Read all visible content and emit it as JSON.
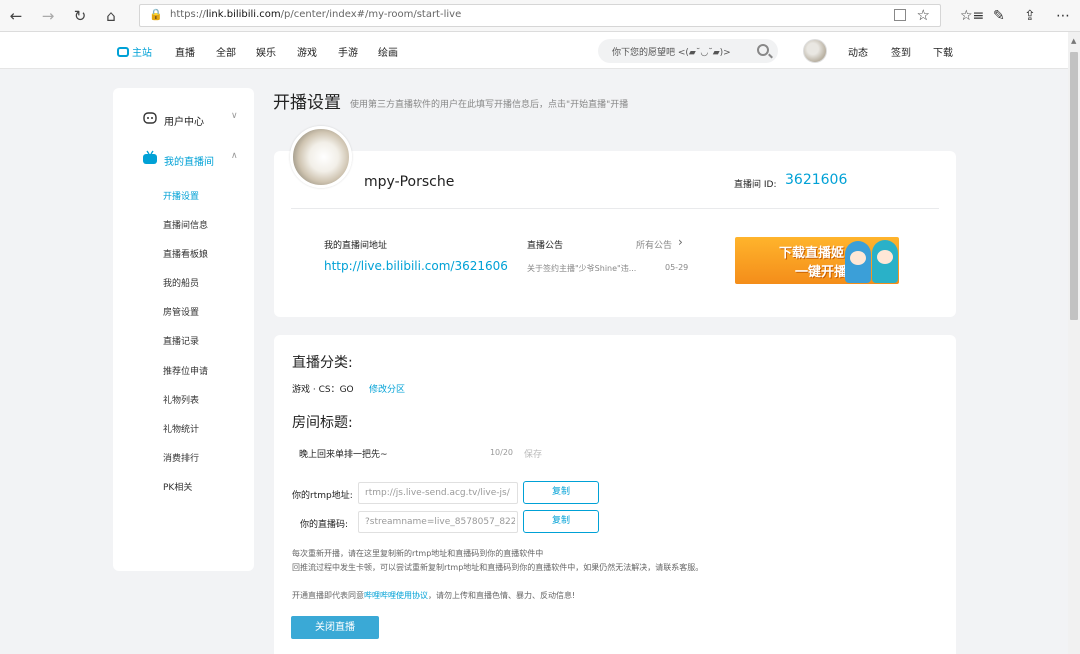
{
  "browser": {
    "back": "←",
    "forward": "→",
    "refresh": "↻",
    "home": "⌂",
    "url_prefix": "https://",
    "url_host": "link.bilibili.com",
    "url_path": "/p/center/index#/my-room/start-live",
    "icons": [
      "back-icon",
      "forward-icon",
      "refresh-icon",
      "home-icon",
      "lock-icon",
      "reading-view-icon",
      "favorite-star-icon",
      "favorites-icon",
      "pen-icon",
      "share-icon",
      "more-icon"
    ]
  },
  "header": {
    "nav": [
      "主站",
      "直播",
      "全部",
      "娱乐",
      "游戏",
      "手游",
      "绘画"
    ],
    "search_placeholder": "你下您的愿望吧 <(▰˘◡˘▰)>",
    "right_links": [
      "动态",
      "签到",
      "下载"
    ]
  },
  "sidebar": {
    "groups": [
      {
        "label": "用户中心",
        "chevron": "∨"
      },
      {
        "label": "我的直播间",
        "chevron": "∧"
      }
    ],
    "items": [
      "开播设置",
      "直播间信息",
      "直播看板娘",
      "我的船员",
      "房管设置",
      "直播记录",
      "推荐位申请",
      "礼物列表",
      "礼物统计",
      "消费排行",
      "PK相关"
    ],
    "accent_color": "#00a1d6"
  },
  "main": {
    "title": "开播设置",
    "subtitle": "使用第三方直播软件的用户在此填写开播信息后，点击\"开始直播\"开播"
  },
  "room": {
    "username": "mpy-Porsche",
    "room_id_label": "直播间 ID:",
    "room_id": "3621606",
    "address_label": "我的直播间地址",
    "address": "http://live.bilibili.com/3621606",
    "notice_label": "直播公告",
    "notice_all": "所有公告",
    "notice_arrow": "›",
    "notice_text": "关于签约主播\"少爷Shine\"违...",
    "notice_date": "05-29",
    "banner_line1": "下载直播姬",
    "banner_line2": "一键开播"
  },
  "settings": {
    "category_heading": "直播分类:",
    "category_value": "游戏 · CS：GO",
    "category_link": "修改分区",
    "title_heading": "房间标题:",
    "title_value": "晚上回来单排一把先~",
    "title_count": "10/20",
    "save_label": "保存",
    "rtmp_label": "你的rtmp地址:",
    "rtmp_value": "rtmp://js.live-send.acg.tv/live-js/",
    "code_label": "你的直播码:",
    "code_value": "?streamname=live_8578057_822",
    "copy_label": "复制",
    "note1": "每次重新开播，请在这里复制新的rtmp地址和直播码到你的直播软件中",
    "note2": "回推流过程中发生卡顿，可以尝试重新复制rtmp地址和直播码到你的直播软件中，如果仍然无法解决，请联系客服。",
    "note3_pre": "开通直播即代表同意",
    "note3_link": "哔哩哔哩使用协议",
    "note3_post": "，请勿上传和直播色情、暴力、反动信息!",
    "close_button": "关闭直播"
  }
}
